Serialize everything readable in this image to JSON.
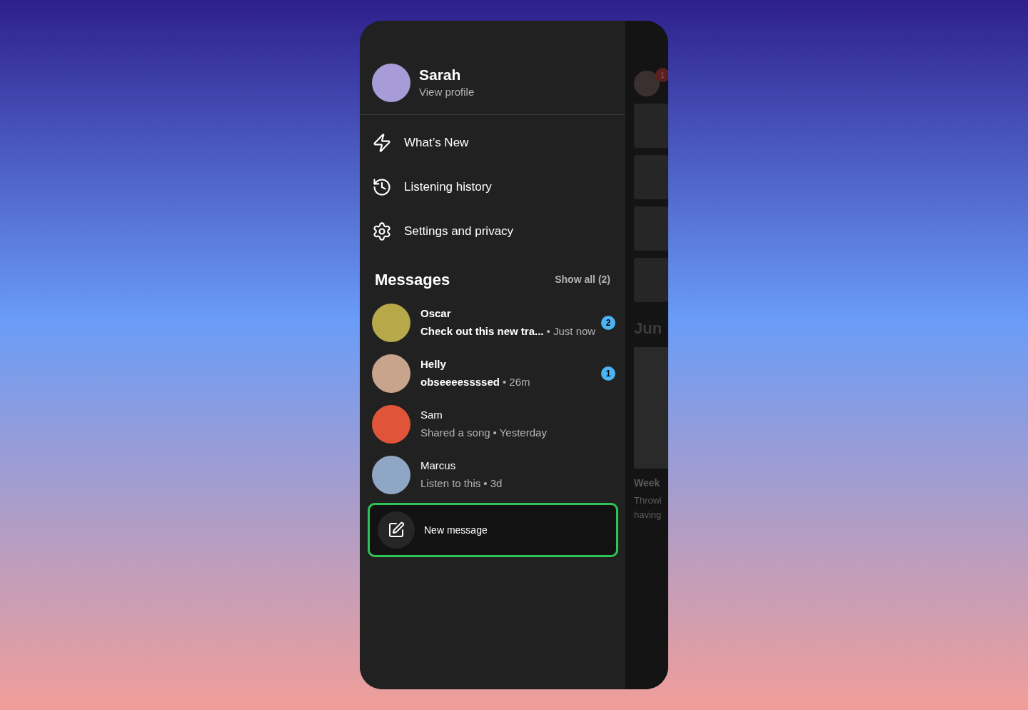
{
  "profile": {
    "name": "Sarah",
    "link": "View profile"
  },
  "menu": [
    {
      "label": "What’s New",
      "kind": "bolt"
    },
    {
      "label": "Listening history",
      "kind": "history"
    },
    {
      "label": "Settings and privacy",
      "kind": "settings"
    }
  ],
  "messages": {
    "title": "Messages",
    "show_all": "Show all (2)",
    "items": [
      {
        "name": "Oscar",
        "preview": "Check out this new tra...",
        "time": "• Just now",
        "unread": true,
        "badge": "2",
        "color": "#b7a84a"
      },
      {
        "name": "Helly",
        "preview": "obseeeessssed",
        "time": "• 26m",
        "unread": true,
        "badge": "1",
        "color": "#c9a48c"
      },
      {
        "name": "Sam",
        "preview": "Shared a song",
        "time": "• Yesterday",
        "unread": false,
        "color": "#e0553a"
      },
      {
        "name": "Marcus",
        "preview": "Listen to this",
        "time": "• 3d",
        "unread": false,
        "color": "#8fa6c4"
      }
    ]
  },
  "new_message": {
    "label": "New message",
    "highlighted": true
  },
  "background_screen": {
    "badge": "1",
    "heading": "Jun",
    "card_title": "Week",
    "card_lines": [
      "Throwi",
      "having"
    ]
  }
}
